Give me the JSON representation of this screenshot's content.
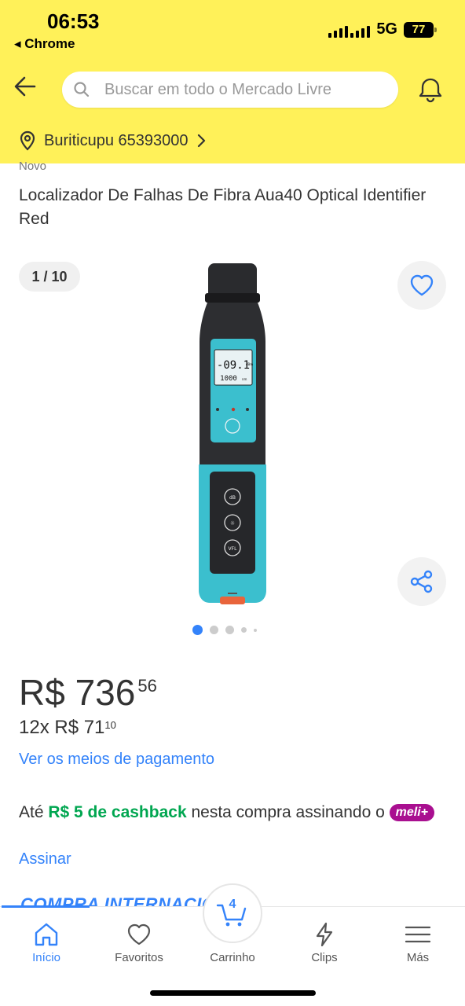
{
  "status_bar": {
    "time": "06:53",
    "back_app": "◂ Chrome",
    "network": "5G",
    "battery": "77"
  },
  "header": {
    "search_placeholder": "Buscar em todo o Mercado Livre",
    "location": "Buriticupu 65393000",
    "background": "#fff159"
  },
  "product": {
    "condition": "Novo",
    "title": "Localizador De Falhas De Fibra Aua40 Optical Identifier Red",
    "image_counter": "1 / 10",
    "image_dots": 5,
    "active_image": 1,
    "device_display": {
      "reading": "-09.1",
      "reading_unit": "dBm",
      "wavelength": "1000",
      "wavelength_unit": "nm",
      "button_labels": [
        "dB",
        "☼",
        "VFL"
      ]
    }
  },
  "pricing": {
    "price_main": "R$ 736",
    "price_cents": "56",
    "installments_main": "12x R$ 71",
    "installments_cents": "10",
    "payment_link": "Ver os meios de pagamento"
  },
  "cashback": {
    "prefix": "Até ",
    "highlight": "R$ 5 de cashback",
    "middle": " nesta compra assinando o ",
    "badge": "meli+",
    "subscribe_link": "Assinar"
  },
  "peek_banner": "COMPRA INTERNACIONAL",
  "bottom_nav": {
    "items": [
      {
        "label": "Início",
        "icon": "home-icon",
        "active": true
      },
      {
        "label": "Favoritos",
        "icon": "heart-icon",
        "active": false
      },
      {
        "label": "Carrinho",
        "icon": "cart-icon",
        "active": false
      },
      {
        "label": "Clips",
        "icon": "lightning-icon",
        "active": false
      },
      {
        "label": "Más",
        "icon": "menu-icon",
        "active": false
      }
    ],
    "cart_count": "4"
  },
  "colors": {
    "accent": "#3483fa",
    "cashback_green": "#00a650",
    "meli_plus": "#a90f90"
  }
}
